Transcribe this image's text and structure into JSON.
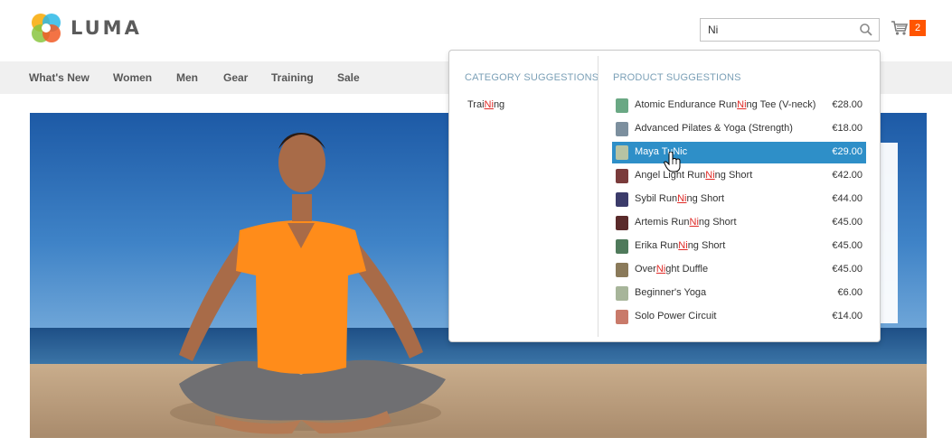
{
  "header": {
    "logo_text": "LUMA",
    "search_value": "Ni",
    "cart_count": "2"
  },
  "nav": {
    "items": [
      "What's New",
      "Women",
      "Men",
      "Gear",
      "Training",
      "Sale"
    ]
  },
  "search_dropdown": {
    "category_title": "CATEGORY SUGGESTIONS",
    "product_title": "PRODUCT SUGGESTIONS",
    "categories": [
      {
        "pre": "Trai",
        "match": "Ni",
        "post": "ng"
      }
    ],
    "products": [
      {
        "pre": "Atomic Endurance Run",
        "match": "Ni",
        "post": "ng Tee (V-neck)",
        "price": "€28.00",
        "thumb": "#6aa884"
      },
      {
        "pre": "Advanced Pilates & Yoga (Strength)",
        "match": "",
        "post": "",
        "price": "€18.00",
        "thumb": "#7c8f9e"
      },
      {
        "pre": "Maya Tu",
        "match": "Ni",
        "post": "c",
        "price": "€29.00",
        "thumb": "#b7c3a3",
        "active": true
      },
      {
        "pre": "Angel Light Run",
        "match": "Ni",
        "post": "ng Short",
        "price": "€42.00",
        "thumb": "#7a3b3b"
      },
      {
        "pre": "Sybil Run",
        "match": "Ni",
        "post": "ng Short",
        "price": "€44.00",
        "thumb": "#3b3b6a"
      },
      {
        "pre": "Artemis Run",
        "match": "Ni",
        "post": "ng Short",
        "price": "€45.00",
        "thumb": "#5a2a2a"
      },
      {
        "pre": "Erika Run",
        "match": "Ni",
        "post": "ng Short",
        "price": "€45.00",
        "thumb": "#4f7a5b"
      },
      {
        "pre": "Over",
        "match": "Ni",
        "post": "ght Duffle",
        "price": "€45.00",
        "thumb": "#8a7a5a"
      },
      {
        "pre": "Beginner's Yoga",
        "match": "",
        "post": "",
        "price": "€6.00",
        "thumb": "#a7b59a"
      },
      {
        "pre": "Solo Power Circuit",
        "match": "",
        "post": "",
        "price": "€14.00",
        "thumb": "#c97a6a"
      }
    ]
  },
  "colors": {
    "accent": "#2e8fc8",
    "highlight": "#e02b27",
    "cart_badge": "#ff5501"
  }
}
